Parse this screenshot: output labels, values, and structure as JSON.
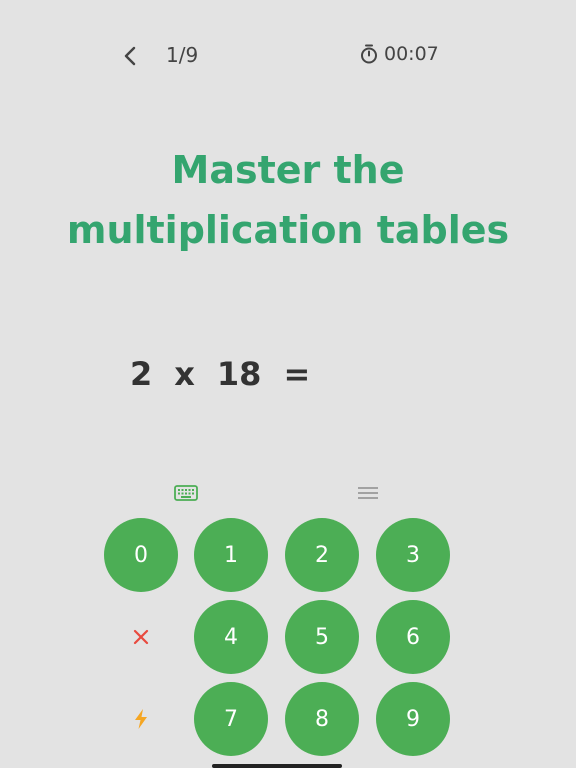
{
  "header": {
    "progress": "1/9",
    "timer": "00:07"
  },
  "title": {
    "line1": "Master the",
    "line2": "multiplication tables"
  },
  "equation": {
    "a": "2",
    "op": "x",
    "b": "18",
    "eq": "="
  },
  "keypad": {
    "keys": [
      "0",
      "1",
      "2",
      "3",
      "4",
      "5",
      "6",
      "7",
      "8",
      "9"
    ]
  },
  "colors": {
    "accent": "#34a56f",
    "key_bg": "#4cae55",
    "clear": "#e84a3f",
    "bolt": "#f5a623",
    "background": "#e3e3e3"
  },
  "icons": {
    "back": "chevron-left-icon",
    "timer": "stopwatch-icon",
    "keyboard": "keyboard-icon",
    "menu": "menu-icon",
    "clear": "close-icon",
    "bolt": "lightning-icon"
  }
}
